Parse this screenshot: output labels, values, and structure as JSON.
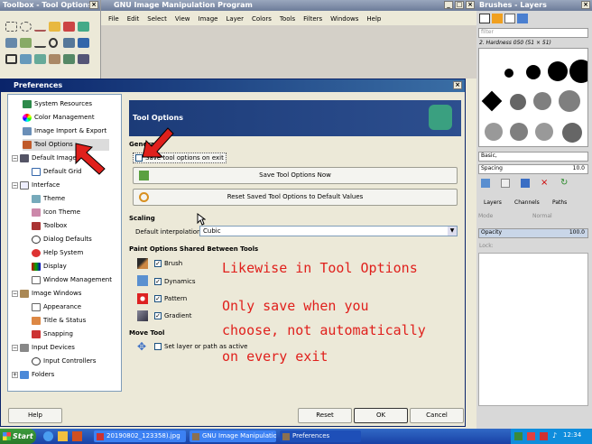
{
  "toolbox": {
    "title": "Toolbox - Tool Options"
  },
  "gimp": {
    "title": "GNU Image Manipulation Program",
    "menu": [
      "File",
      "Edit",
      "Select",
      "View",
      "Image",
      "Layer",
      "Colors",
      "Tools",
      "Filters",
      "Windows",
      "Help"
    ]
  },
  "brushes": {
    "title": "Brushes - Layers",
    "filter_placeholder": "filter",
    "brush_name": "2. Hardness 050 (51 × 51)",
    "preset": "Basic,",
    "spacing_label": "Spacing",
    "spacing_value": "10.0"
  },
  "layers": {
    "tabs": [
      "Layers",
      "Channels",
      "Paths"
    ],
    "mode_label": "Mode",
    "mode_value": "Normal",
    "opacity_label": "Opacity",
    "opacity_value": "100.0",
    "lock_label": "Lock:"
  },
  "prefs": {
    "title": "Preferences",
    "tree": [
      "System Resources",
      "Color Management",
      "Image Import & Export",
      "Tool Options",
      "Default Image",
      "Default Grid",
      "Interface",
      "Theme",
      "Icon Theme",
      "Toolbox",
      "Dialog Defaults",
      "Help System",
      "Display",
      "Window Management",
      "Image Windows",
      "Appearance",
      "Title & Status",
      "Snapping",
      "Input Devices",
      "Input Controllers",
      "Folders"
    ],
    "header": "Tool Options",
    "general_label": "General",
    "save_on_exit": "Save tool options on exit",
    "save_now": "Save Tool Options Now",
    "reset_saved": "Reset Saved Tool Options to Default Values",
    "scaling_label": "Scaling",
    "interp_label": "Default interpolation:",
    "interp_value": "Cubic",
    "paint_label": "Paint Options Shared Between Tools",
    "paint_items": [
      "Brush",
      "Dynamics",
      "Pattern",
      "Gradient"
    ],
    "move_label": "Move Tool",
    "move_item": "Set layer or path as active",
    "help_btn": "Help",
    "reset_btn": "Reset",
    "ok_btn": "OK",
    "cancel_btn": "Cancel"
  },
  "annotation": {
    "line1": "Likewise in Tool Options",
    "line2": "Only save when you",
    "line3": "choose, not automatically",
    "line4": "on every exit"
  },
  "taskbar": {
    "start": "Start",
    "items": [
      "20190802_123358).jpg",
      "GNU Image Manipulation ...",
      "Preferences"
    ],
    "clock": "12:34"
  },
  "colors": {
    "accent": "#0a246a",
    "annotation": "#e0201c",
    "taskbar": "#245edb"
  }
}
